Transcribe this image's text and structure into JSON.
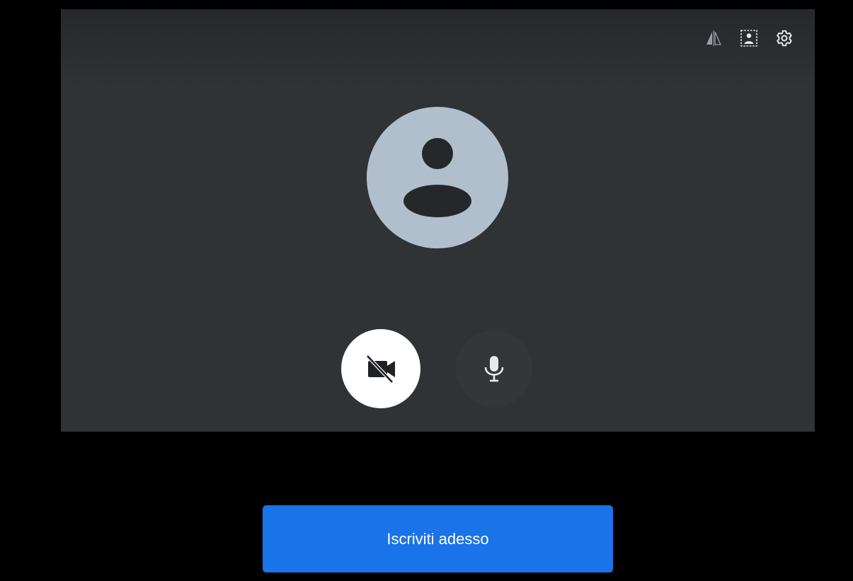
{
  "preview": {
    "top_tools": [
      {
        "icon": "mirror-icon"
      },
      {
        "icon": "background-effects-icon"
      },
      {
        "icon": "gear-icon"
      }
    ],
    "avatar_icon": "person-icon",
    "camera": {
      "icon": "videocam-off-icon",
      "state": "off"
    },
    "microphone": {
      "icon": "mic-icon",
      "state": "on"
    }
  },
  "join_button": {
    "label": "Iscriviti adesso"
  },
  "colors": {
    "page_background": "#000000",
    "preview_background": "#303336",
    "avatar_background": "#b1bfcc",
    "join_button": "#1a73e8",
    "camera_button": "#ffffff",
    "mic_button": "#34373a"
  }
}
